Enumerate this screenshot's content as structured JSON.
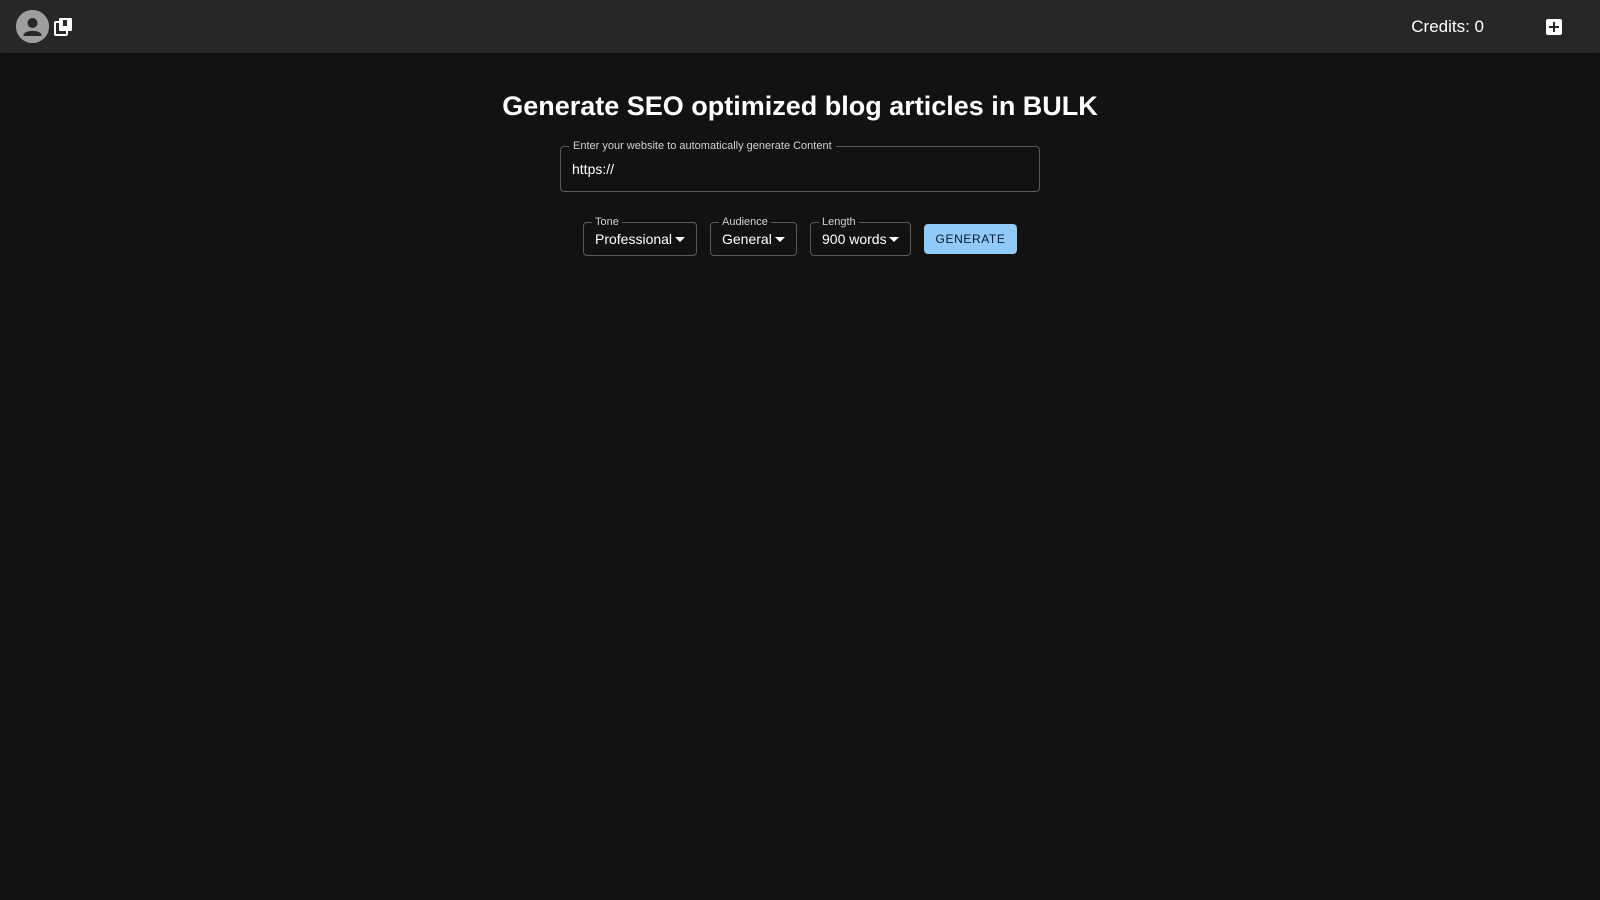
{
  "header": {
    "credits_label": "Credits: 0",
    "icons": [
      "account-icon",
      "library-icon",
      "add-box-icon"
    ]
  },
  "main": {
    "headline": "Generate SEO optimized blog articles in BULK",
    "website_field": {
      "label": "Enter your website to automatically generate Content",
      "value": "https://"
    },
    "tone": {
      "label": "Tone",
      "value": "Professional"
    },
    "audience": {
      "label": "Audience",
      "value": "General"
    },
    "length": {
      "label": "Length",
      "value": "900 words"
    },
    "generate_label": "GENERATE"
  },
  "colors": {
    "background": "#121212",
    "topbar": "#272727",
    "accent": "#90caf9"
  }
}
